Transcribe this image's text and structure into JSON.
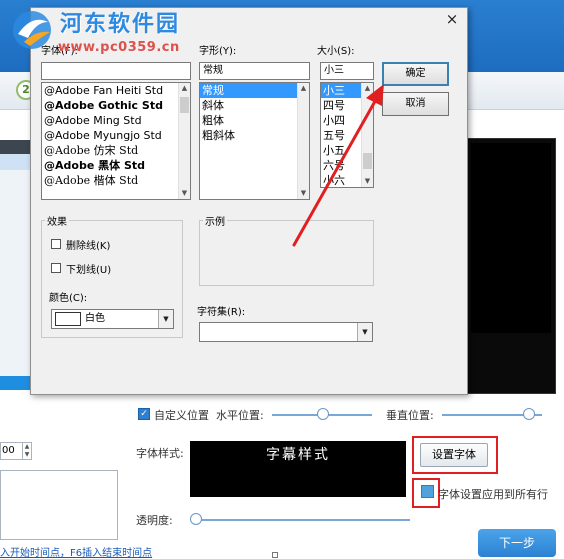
{
  "watermark": {
    "title": "河东软件园",
    "url": "www.pc0359.cn"
  },
  "toolbar": {
    "step_badge": "2"
  },
  "dialog": {
    "close_glyph": "×",
    "font_label": "字体(F):",
    "style_label": "字形(Y):",
    "size_label": "大小(S):",
    "font_value": "",
    "style_value": "常规",
    "size_value": "小三",
    "font_list": [
      "@Adobe Fan Heiti Std",
      "@Adobe Gothic Std",
      "@Adobe Ming Std",
      "@Adobe Myungjo Std",
      "@Adobe 仿宋 Std",
      "@Adobe 黑体 Std",
      "@Adobe 楷体 Std"
    ],
    "style_list": [
      "常规",
      "斜体",
      "粗体",
      "粗斜体"
    ],
    "size_list": [
      "小三",
      "四号",
      "小四",
      "五号",
      "小五",
      "六号",
      "小六"
    ],
    "ok_label": "确定",
    "cancel_label": "取消",
    "effects_title": "效果",
    "strikeout_label": "删除线(K)",
    "underline_label": "下划线(U)",
    "color_label": "颜色(C):",
    "color_value": "白色",
    "sample_title": "示例",
    "charset_label": "字符集(R):",
    "charset_value": ""
  },
  "app": {
    "custom_position_label": "自定义位置",
    "horizontal_label": "水平位置:",
    "vertical_label": "垂直位置:",
    "font_style_label": "字体样式:",
    "subtitle_preview_text": "字幕样式",
    "set_font_button": "设置字体",
    "apply_all_label": "字体设置应用到所有行",
    "opacity_label": "透明度:",
    "spin_value": "00",
    "hint_text": "入开始时间点，F6插入结束时间点",
    "next_button": "下一步"
  },
  "colors": {
    "accent": "#2f7fd1",
    "highlight_red": "#e02020",
    "selection": "#3399ff"
  }
}
